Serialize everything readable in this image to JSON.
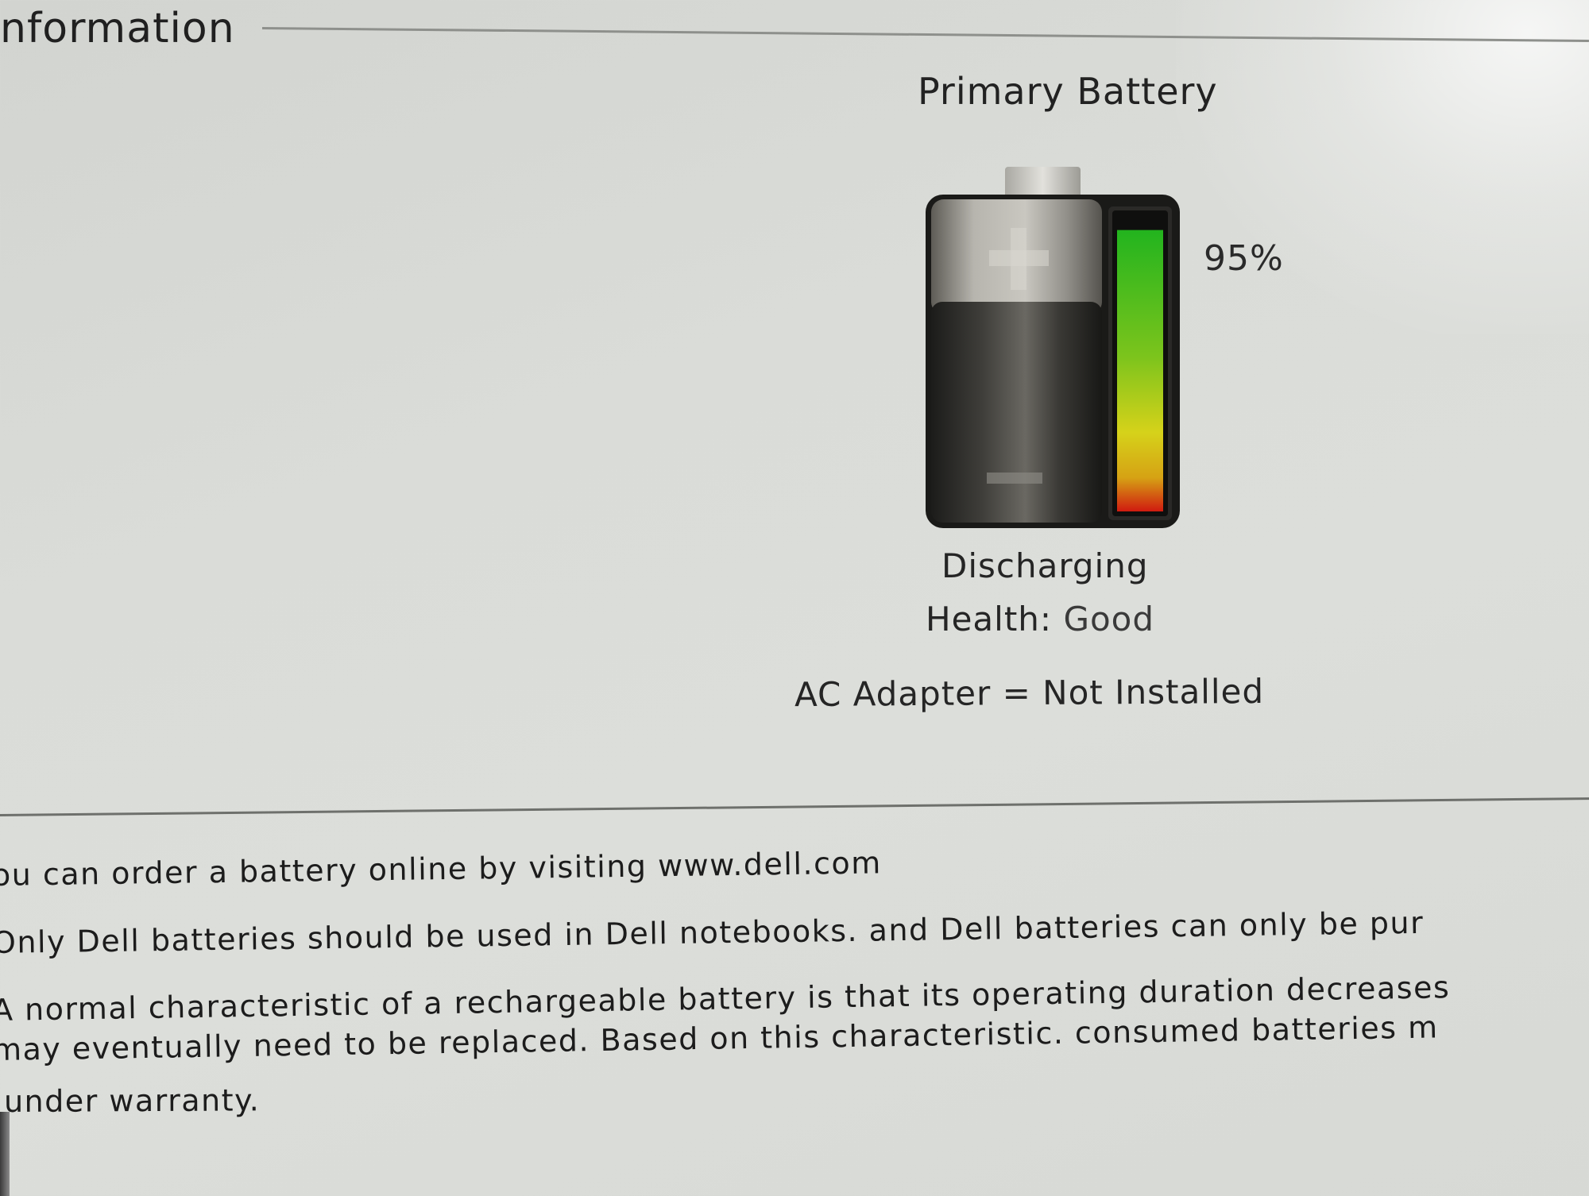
{
  "group": {
    "title": "nformation"
  },
  "battery": {
    "title": "Primary Battery",
    "charge_percent_label": "95%",
    "charge_fraction": 0.95,
    "status": "Discharging",
    "health_label": "Health:",
    "health_value": "Good",
    "ac_adapter": "AC Adapter = Not Installed",
    "icon": "battery-icon",
    "colors": {
      "level_high": "#22b41e",
      "level_mid": "#d6d21a",
      "level_low": "#d01a10"
    }
  },
  "info": {
    "line1": "ou can order a battery online by visiting www.dell.com",
    "line2": "Only Dell batteries should be used in Dell notebooks. and Dell batteries can only be pur",
    "line3": "A normal characteristic of a rechargeable battery is that its operating duration decreases",
    "line4": "may eventually need to be replaced.  Based on this characteristic. consumed batteries m",
    "line5": "under warranty."
  }
}
